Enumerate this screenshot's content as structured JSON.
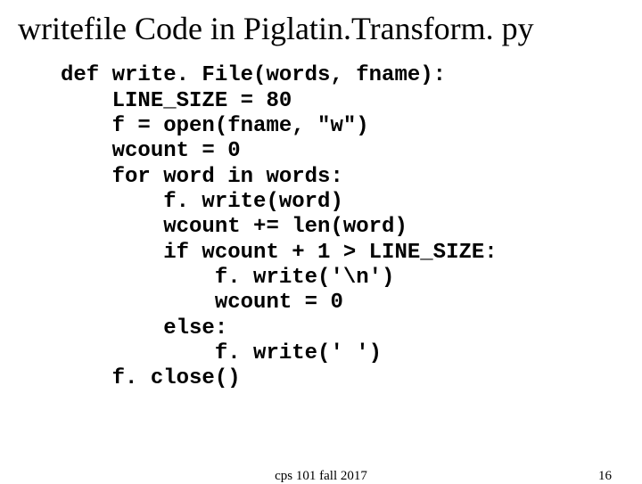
{
  "title": "writefile Code in Piglatin.Transform. py",
  "code": {
    "l1": "def write. File(words, fname):",
    "l2": "    LINE_SIZE = 80",
    "l3": "    f = open(fname, \"w\")",
    "l4": "    wcount = 0",
    "l5": "    for word in words:",
    "l6": "        f. write(word)",
    "l7": "        wcount += len(word)",
    "l8": "        if wcount + 1 > LINE_SIZE:",
    "l9": "            f. write('\\n')",
    "l10": "            wcount = 0",
    "l11": "        else:",
    "l12": "            f. write(' ')",
    "l13": "    f. close()"
  },
  "footer": {
    "course": "cps 101 fall 2017",
    "page": "16"
  }
}
